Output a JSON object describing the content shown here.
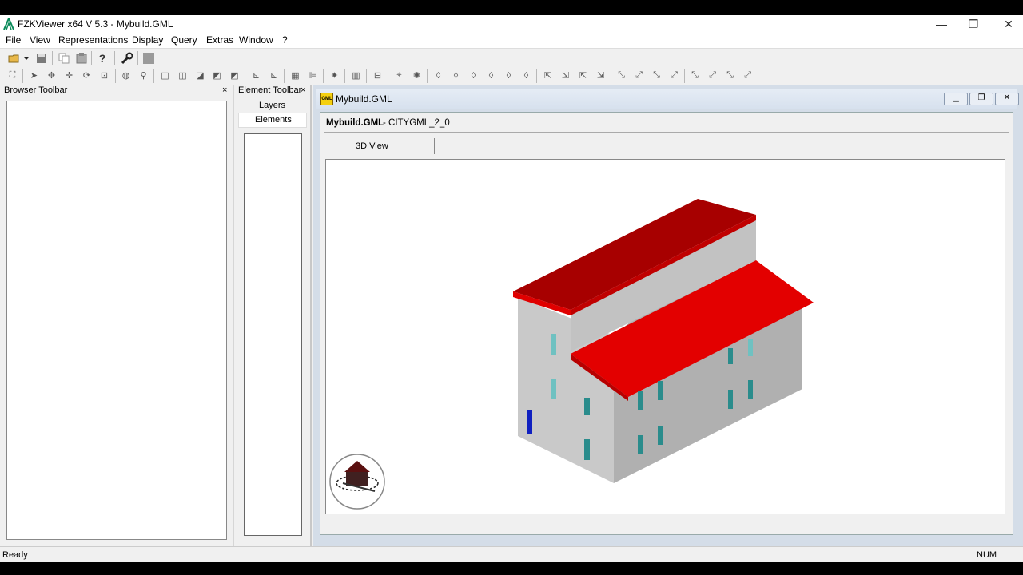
{
  "window": {
    "title": "FZKViewer x64 V 5.3 - Mybuild.GML",
    "minimize_glyph": "—",
    "restore_glyph": "❐",
    "close_glyph": "✕"
  },
  "menu": [
    "File",
    "View",
    "Representations",
    "Display",
    "Query",
    "Extras",
    "Window",
    "?"
  ],
  "toolbar1": {
    "icons": [
      "open-folder-icon",
      "save-icon",
      "copy-icon",
      "paste-icon",
      "help-icon",
      "wrench-icon",
      "stop-icon"
    ]
  },
  "browser_panel": {
    "title": "Browser Toolbar",
    "close": "×"
  },
  "element_panel": {
    "title": "Element Toolbar",
    "close": "×",
    "tabs": [
      "Layers",
      "Elements"
    ]
  },
  "document": {
    "window_title": "Mybuild.GML",
    "file_name": "Mybuild.GML",
    "format": " - CITYGML_2_0",
    "tab": "3D View",
    "icon_text": "GML"
  },
  "status": {
    "left": "Ready",
    "right": "NUM"
  },
  "colors": {
    "roof": "#e30000",
    "roof_dark": "#a00000",
    "wall_light": "#c8c8c8",
    "wall_dark": "#a9a9a9",
    "window": "#2a8c8c",
    "door": "#1020c0"
  }
}
